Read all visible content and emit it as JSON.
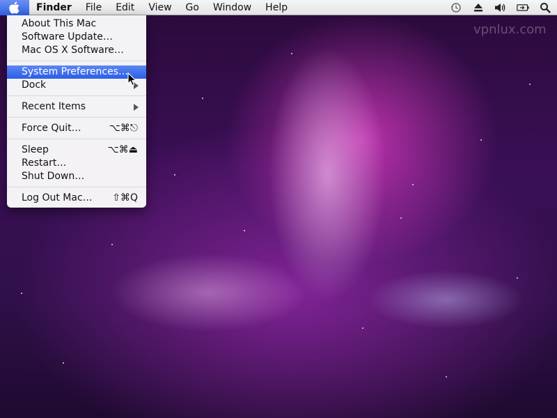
{
  "menubar": {
    "app_name": "Finder",
    "menus": [
      "File",
      "Edit",
      "View",
      "Go",
      "Window",
      "Help"
    ],
    "status_icons": [
      "time-machine-icon",
      "eject-icon",
      "volume-icon",
      "battery-icon",
      "spotlight-search-icon"
    ]
  },
  "apple_menu": {
    "items": [
      {
        "label": "About This Mac"
      },
      {
        "label": "Software Update…"
      },
      {
        "label": "Mac OS X Software…"
      },
      {
        "label": "System Preferences…"
      },
      {
        "label": "Dock"
      },
      {
        "label": "Recent Items"
      },
      {
        "label": "Force Quit…",
        "shortcut": "⌥⌘⎋"
      },
      {
        "label": "Sleep",
        "shortcut": "⌥⌘⏏"
      },
      {
        "label": "Restart…"
      },
      {
        "label": "Shut Down…"
      },
      {
        "label": "Log Out Mac…",
        "shortcut": "⇧⌘Q"
      }
    ],
    "selected_item": "System Preferences…"
  },
  "watermark": "vpnlux.com",
  "colors": {
    "selection": "#2f63e3",
    "menubar": "#ececec",
    "wallpaper_accent": "#d23cc8"
  }
}
